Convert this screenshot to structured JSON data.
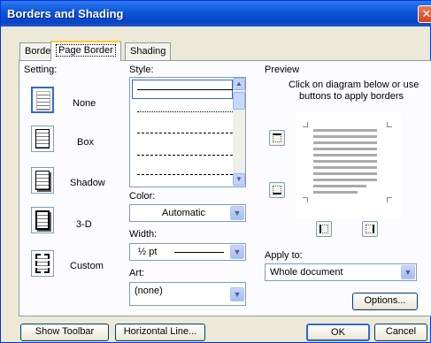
{
  "window": {
    "title": "Borders and Shading",
    "close_glyph": "✕"
  },
  "tabs": [
    {
      "label": "Borders",
      "active": false
    },
    {
      "label": "Page Border",
      "active": true
    },
    {
      "label": "Shading",
      "active": false
    }
  ],
  "setting": {
    "label": "Setting:",
    "items": [
      {
        "label": "None",
        "selected": true
      },
      {
        "label": "Box",
        "selected": false
      },
      {
        "label": "Shadow",
        "selected": false
      },
      {
        "label": "3-D",
        "selected": false
      },
      {
        "label": "Custom",
        "selected": false
      }
    ]
  },
  "style": {
    "label": "Style:"
  },
  "color": {
    "label": "Color:",
    "value": "Automatic"
  },
  "width": {
    "label": "Width:",
    "value": "½ pt"
  },
  "art": {
    "label": "Art:",
    "value": "(none)"
  },
  "preview": {
    "label": "Preview",
    "hint_line1": "Click on diagram below or use",
    "hint_line2": "buttons to apply borders"
  },
  "apply_to": {
    "label": "Apply to:",
    "value": "Whole document"
  },
  "buttons": {
    "options": "Options...",
    "show_toolbar": "Show Toolbar",
    "horizontal_line": "Horizontal Line...",
    "ok": "OK",
    "cancel": "Cancel"
  },
  "icons": {
    "up": "▲",
    "down": "▼"
  },
  "colors": {
    "title_bar": "#0a56d8",
    "selection": "#316ac5",
    "dialog_bg": "#ece9d8"
  }
}
